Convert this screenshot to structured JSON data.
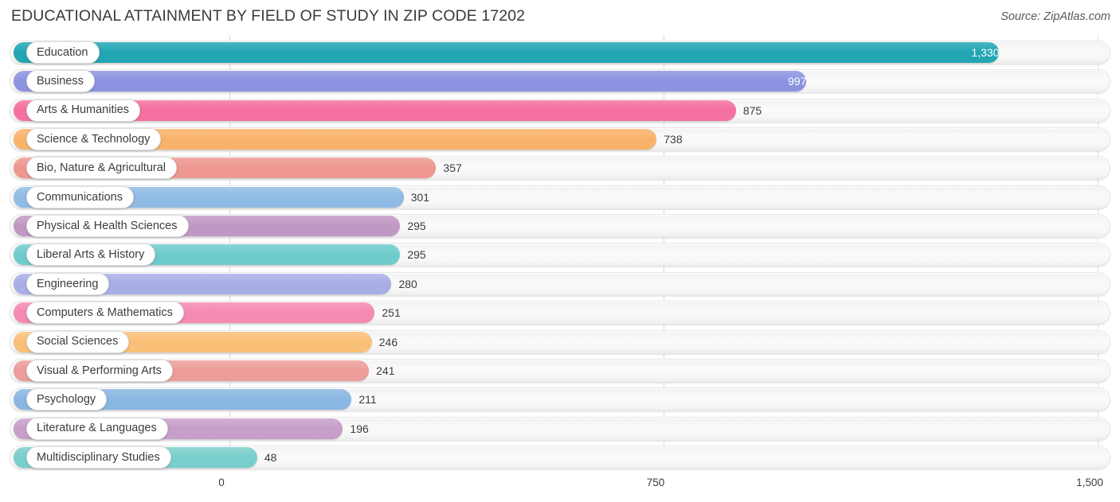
{
  "header": {
    "title": "EDUCATIONAL ATTAINMENT BY FIELD OF STUDY IN ZIP CODE 17202",
    "source": "Source: ZipAtlas.com"
  },
  "chart_data": {
    "type": "bar",
    "orientation": "horizontal",
    "title": "EDUCATIONAL ATTAINMENT BY FIELD OF STUDY IN ZIP CODE 17202",
    "xlabel": "",
    "ylabel": "",
    "xlim": [
      0,
      1500
    ],
    "grid": true,
    "legend": "none",
    "xticks": [
      "0",
      "750",
      "1,500"
    ],
    "xtick_values": [
      0,
      750,
      1500
    ],
    "categories": [
      "Education",
      "Business",
      "Arts & Humanities",
      "Science & Technology",
      "Bio, Nature & Agricultural",
      "Communications",
      "Physical & Health Sciences",
      "Liberal Arts & History",
      "Engineering",
      "Computers & Mathematics",
      "Social Sciences",
      "Visual & Performing Arts",
      "Psychology",
      "Literature & Languages",
      "Multidisciplinary Studies"
    ],
    "values": [
      1330,
      997,
      875,
      738,
      357,
      301,
      295,
      295,
      280,
      251,
      246,
      241,
      211,
      196,
      48
    ],
    "value_labels": [
      "1,330",
      "997",
      "875",
      "738",
      "357",
      "301",
      "295",
      "295",
      "280",
      "251",
      "246",
      "241",
      "211",
      "196",
      "48"
    ],
    "colors": [
      "#22a6b3",
      "#8b93e0",
      "#f470a0",
      "#f9b26a",
      "#ee9790",
      "#8fbbe4",
      "#c098c4",
      "#6ecbcb",
      "#a8aee6",
      "#f489b2",
      "#fbc078",
      "#ed9d99",
      "#89b6e2",
      "#c79ec9",
      "#79cecc"
    ],
    "label_inside": [
      true,
      true,
      false,
      false,
      false,
      false,
      false,
      false,
      false,
      false,
      false,
      false,
      false,
      false,
      false
    ]
  }
}
